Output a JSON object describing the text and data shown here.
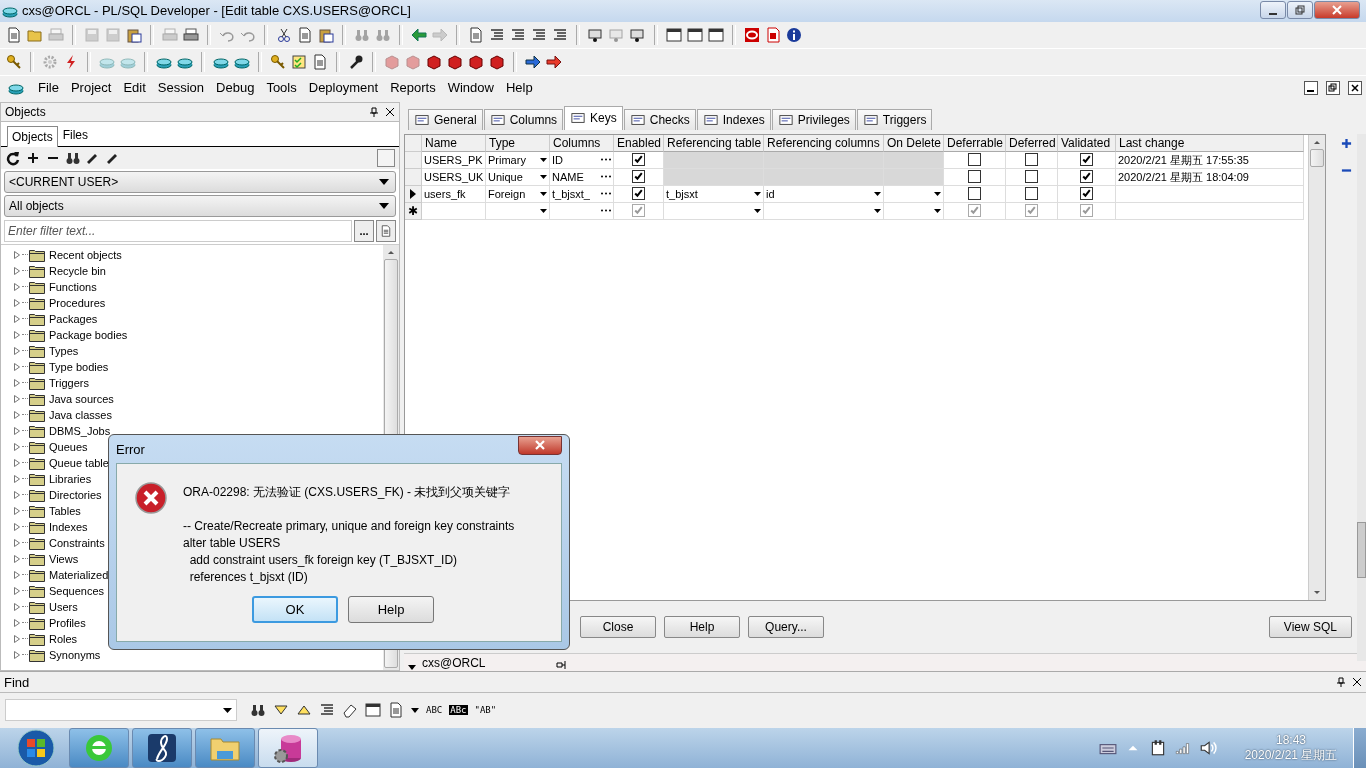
{
  "window": {
    "title": "cxs@ORCL - PL/SQL Developer - [Edit table CXS.USERS@ORCL]"
  },
  "menu": [
    "File",
    "Project",
    "Edit",
    "Session",
    "Debug",
    "Tools",
    "Deployment",
    "Reports",
    "Window",
    "Help"
  ],
  "objects_panel": {
    "title": "Objects",
    "tabs": [
      {
        "label": "Objects",
        "selected": true
      },
      {
        "label": "Files",
        "selected": false
      }
    ],
    "owner": "<CURRENT USER>",
    "object_filter": "All objects",
    "search": {
      "placeholder": "Enter filter text...",
      "button": "..."
    },
    "tree": [
      {
        "label": "Recent objects",
        "expanded": false
      },
      {
        "label": "Recycle bin",
        "expanded": false
      },
      {
        "label": "Functions",
        "expanded": false
      },
      {
        "label": "Procedures",
        "expanded": false
      },
      {
        "label": "Packages",
        "expanded": false
      },
      {
        "label": "Package bodies",
        "expanded": false
      },
      {
        "label": "Types",
        "expanded": false
      },
      {
        "label": "Type bodies",
        "expanded": false
      },
      {
        "label": "Triggers",
        "expanded": false
      },
      {
        "label": "Java sources",
        "expanded": false
      },
      {
        "label": "Java classes",
        "expanded": false
      },
      {
        "label": "DBMS_Jobs",
        "expanded": false
      },
      {
        "label": "Queues",
        "expanded": false
      },
      {
        "label": "Queue table",
        "expanded": false
      },
      {
        "label": "Libraries",
        "expanded": false
      },
      {
        "label": "Directories",
        "expanded": false
      },
      {
        "label": "Tables",
        "expanded": false
      },
      {
        "label": "Indexes",
        "expanded": false
      },
      {
        "label": "Constraints",
        "expanded": false
      },
      {
        "label": "Views",
        "expanded": false
      },
      {
        "label": "Materialized",
        "expanded": false
      },
      {
        "label": "Sequences",
        "expanded": false
      },
      {
        "label": "Users",
        "expanded": false
      },
      {
        "label": "Profiles",
        "expanded": false
      },
      {
        "label": "Roles",
        "expanded": false
      },
      {
        "label": "Synonyms",
        "expanded": false
      }
    ]
  },
  "editor": {
    "tabs": [
      {
        "label": "General",
        "selected": false
      },
      {
        "label": "Columns",
        "selected": false
      },
      {
        "label": "Keys",
        "selected": true
      },
      {
        "label": "Checks",
        "selected": false
      },
      {
        "label": "Indexes",
        "selected": false
      },
      {
        "label": "Privileges",
        "selected": false
      },
      {
        "label": "Triggers",
        "selected": false
      }
    ],
    "grid": {
      "columns": [
        "Name",
        "Type",
        "Columns",
        "Enabled",
        "Referencing table",
        "Referencing columns",
        "On Delete",
        "Deferrable",
        "Deferred",
        "Validated",
        "Last change"
      ],
      "rows": [
        {
          "selected": false,
          "name": "USERS_PK",
          "type": "Primary",
          "columns": "ID",
          "enabled": true,
          "referencing_disabled": true,
          "deferrable": false,
          "deferred": false,
          "validated": true,
          "last_change": "2020/2/21 星期五 17:55:35"
        },
        {
          "selected": false,
          "name": "USERS_UK",
          "type": "Unique",
          "columns": "NAME",
          "enabled": true,
          "referencing_disabled": true,
          "deferrable": false,
          "deferred": false,
          "validated": true,
          "last_change": "2020/2/21 星期五 18:04:09"
        },
        {
          "selected": true,
          "name": "users_fk",
          "type": "Foreign",
          "columns": "t_bjsxt_",
          "enabled": true,
          "referencing_disabled": false,
          "referencing_table": "t_bjsxt",
          "referencing_columns": "id",
          "deferrable": false,
          "deferred": false,
          "validated": true
        },
        {
          "selected": false,
          "kind": "new",
          "marker": "✱",
          "enabled": true,
          "referencing_disabled": false,
          "deferrable": true,
          "deferred": true,
          "validated": true
        }
      ]
    },
    "buttons": [
      "Close",
      "Help",
      "Query...",
      "View SQL"
    ],
    "connection": "cxs@ORCL"
  },
  "find": {
    "title": "Find",
    "options": [
      "ABC",
      "ABc",
      "\"AB\""
    ]
  },
  "error_dialog": {
    "title": "Error",
    "heading": "ORA-02298: 无法验证 (CXS.USERS_FK) - 未找到父项关键字",
    "sql": "-- Create/Recreate primary, unique and foreign key constraints\nalter table USERS\n  add constraint users_fk foreign key (T_BJSXT_ID)\n  references t_bjsxt (ID)",
    "buttons": [
      {
        "label": "OK",
        "default": true
      },
      {
        "label": "Help",
        "default": false
      }
    ]
  },
  "taskbar": {
    "time": "18:43",
    "date": "2020/2/21 星期五"
  }
}
